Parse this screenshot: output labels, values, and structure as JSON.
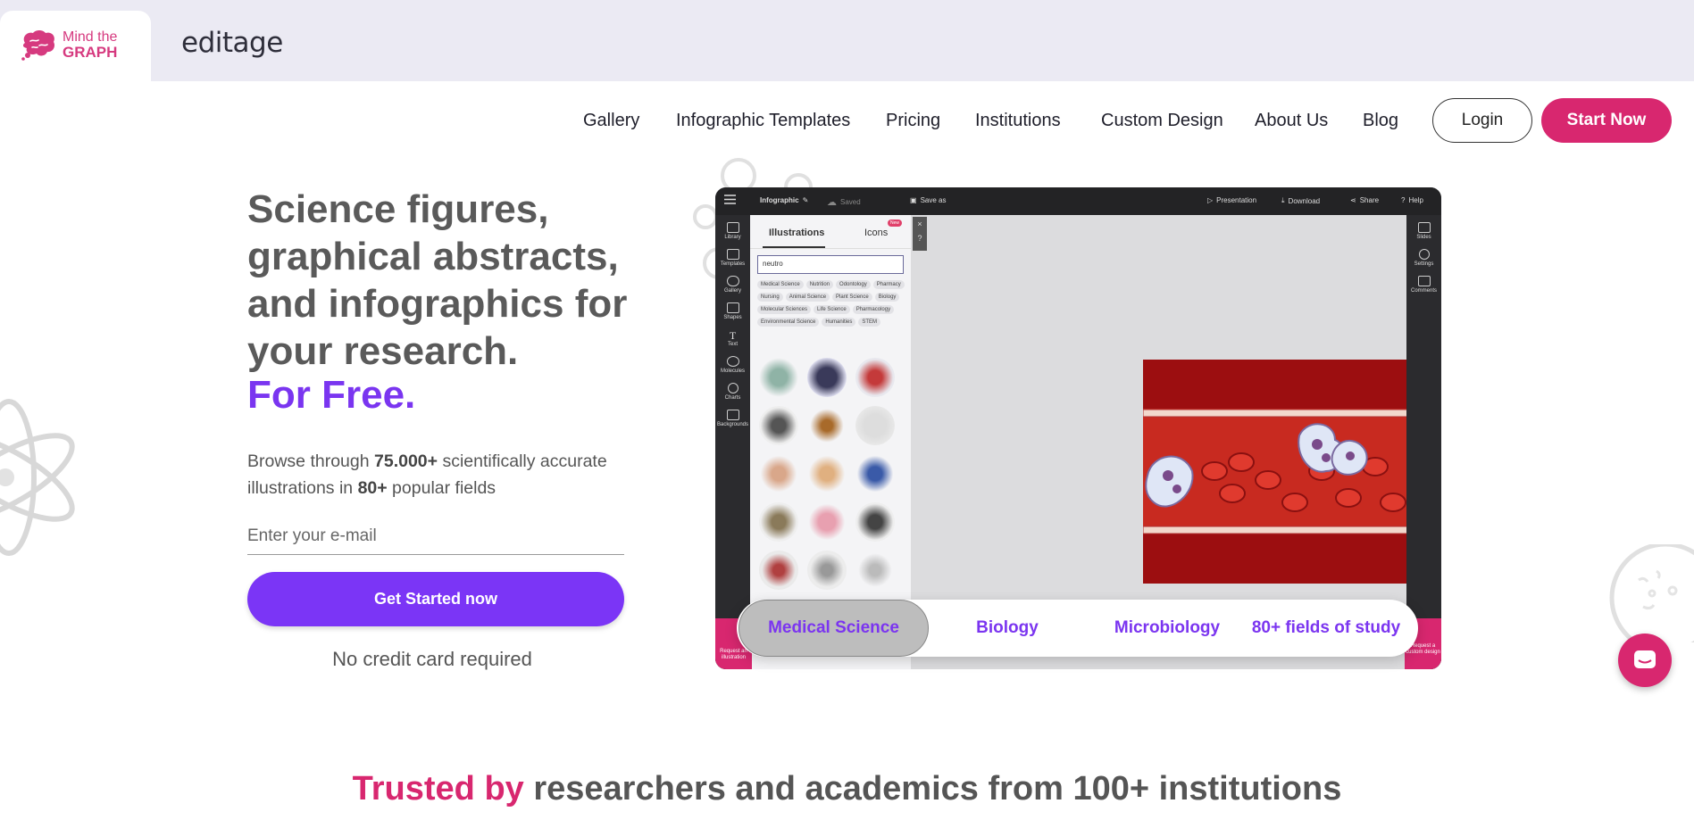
{
  "brand": {
    "logo_line1": "Mind the",
    "logo_line2": "GRAPH",
    "partner": "editage"
  },
  "nav": {
    "links": [
      "Gallery",
      "Infographic Templates",
      "Pricing",
      "Institutions",
      "Custom Design",
      "About Us",
      "Blog"
    ],
    "login": "Login",
    "start": "Start Now"
  },
  "hero": {
    "title": "Science figures, graphical abstracts, and infographics for your research.",
    "free": "For Free.",
    "desc_pre": "Browse through ",
    "desc_count": "75.000+",
    "desc_mid": " scientifically accurate illustrations in ",
    "desc_fields": "80+",
    "desc_post": " popular fields",
    "email_placeholder": "Enter your e-mail",
    "cta": "Get Started now",
    "no_card": "No credit card required"
  },
  "app": {
    "top_left": "Infographic",
    "saved": "Saved",
    "save_as": "Save as",
    "presentation": "Presentation",
    "download": "Download",
    "share": "Share",
    "help": "Help",
    "left_items": [
      "Library",
      "Templates",
      "Gallery",
      "Shapes",
      "Text",
      "Molecules",
      "Charts",
      "Backgrounds"
    ],
    "right_items": [
      "Slides",
      "Settings",
      "Comments"
    ],
    "tab_illustrations": "Illustrations",
    "tab_icons": "Icons",
    "new_badge": "New",
    "search_value": "neutro",
    "chips": [
      "Medical Science",
      "Nutrition",
      "Odontology",
      "Pharmacy",
      "Nursing",
      "Animal Science",
      "Plant Science",
      "Biology",
      "Molecular Sciences",
      "Life Science",
      "Pharmacology",
      "Environmental Science",
      "Humanities",
      "STEM"
    ],
    "request_illustration": "Request an illustration",
    "request_design": "Request a custom design"
  },
  "fields": {
    "items": [
      "Medical Science",
      "Biology",
      "Microbiology",
      "80+ fields of study"
    ],
    "active": "Medical Science"
  },
  "trusted": {
    "highlight": "Trusted by",
    "rest": " researchers and academics from 100+ institutions"
  },
  "colors": {
    "brand_pink": "#d8276f",
    "brand_purple": "#7b35f6"
  }
}
